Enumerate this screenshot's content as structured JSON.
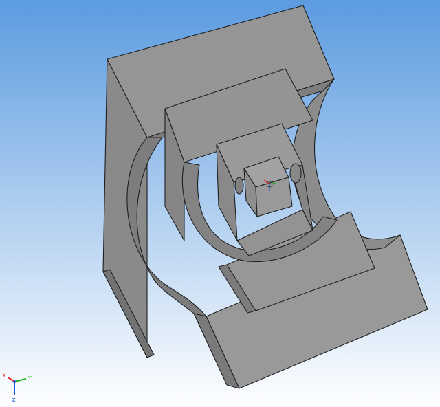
{
  "viewport": {
    "background_top": "#5b9be0",
    "background_bottom": "#ffffff",
    "model_face_color": "#8f8f8f",
    "model_edge_color": "#1e1e1e"
  },
  "triad": {
    "x_label": "X",
    "y_label": "Y",
    "z_label": "Z",
    "x_color": "#e02020",
    "y_color": "#20b020",
    "z_color": "#1a5ad8"
  },
  "origin_marker": {
    "x_color": "#e02020",
    "y_color": "#20b020",
    "z_color": "#1a5ad8"
  }
}
